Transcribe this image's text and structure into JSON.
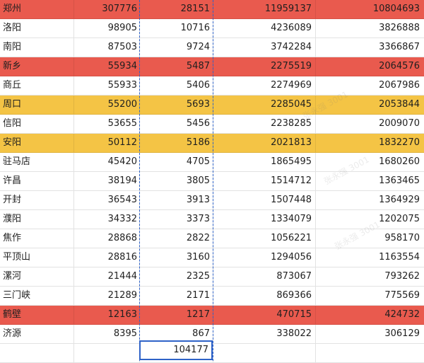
{
  "rows": [
    {
      "city": "郑州",
      "c1": "307776",
      "c2": "28151",
      "c3": "11959137",
      "c4": "10804693",
      "highlight": "red"
    },
    {
      "city": "洛阳",
      "c1": "98905",
      "c2": "10716",
      "c3": "4236089",
      "c4": "3826888",
      "highlight": ""
    },
    {
      "city": "南阳",
      "c1": "87503",
      "c2": "9724",
      "c3": "3742284",
      "c4": "3366867",
      "highlight": ""
    },
    {
      "city": "新乡",
      "c1": "55934",
      "c2": "5487",
      "c3": "2275519",
      "c4": "2064576",
      "highlight": "red"
    },
    {
      "city": "商丘",
      "c1": "55933",
      "c2": "5406",
      "c3": "2274969",
      "c4": "2067986",
      "highlight": ""
    },
    {
      "city": "周口",
      "c1": "55200",
      "c2": "5693",
      "c3": "2285045",
      "c4": "2053844",
      "highlight": "yellow"
    },
    {
      "city": "信阳",
      "c1": "53655",
      "c2": "5456",
      "c3": "2238285",
      "c4": "2009070",
      "highlight": ""
    },
    {
      "city": "安阳",
      "c1": "50112",
      "c2": "5186",
      "c3": "2021813",
      "c4": "1832270",
      "highlight": "yellow"
    },
    {
      "city": "驻马店",
      "c1": "45420",
      "c2": "4705",
      "c3": "1865495",
      "c4": "1680260",
      "highlight": ""
    },
    {
      "city": "许昌",
      "c1": "38194",
      "c2": "3805",
      "c3": "1514712",
      "c4": "1363465",
      "highlight": ""
    },
    {
      "city": "开封",
      "c1": "36543",
      "c2": "3913",
      "c3": "1507448",
      "c4": "1364929",
      "highlight": ""
    },
    {
      "city": "濮阳",
      "c1": "34332",
      "c2": "3373",
      "c3": "1334079",
      "c4": "1202075",
      "highlight": ""
    },
    {
      "city": "焦作",
      "c1": "28868",
      "c2": "2822",
      "c3": "1056221",
      "c4": "958170",
      "highlight": ""
    },
    {
      "city": "平顶山",
      "c1": "28816",
      "c2": "3160",
      "c3": "1294056",
      "c4": "1163554",
      "highlight": ""
    },
    {
      "city": "漯河",
      "c1": "21444",
      "c2": "2325",
      "c3": "873067",
      "c4": "793262",
      "highlight": ""
    },
    {
      "city": "三门峡",
      "c1": "21289",
      "c2": "2171",
      "c3": "869366",
      "c4": "775569",
      "highlight": ""
    },
    {
      "city": "鹤壁",
      "c1": "12163",
      "c2": "1217",
      "c3": "470715",
      "c4": "424732",
      "highlight": "red"
    },
    {
      "city": "济源",
      "c1": "8395",
      "c2": "867",
      "c3": "338022",
      "c4": "306129",
      "highlight": ""
    },
    {
      "city": "",
      "c1": "",
      "c2": "",
      "c3": "",
      "c4": "",
      "highlight": ""
    }
  ],
  "sum_cell": "104177",
  "colors": {
    "red": "#e95a4e",
    "yellow": "#f4c445",
    "selection": "#2f63c8"
  },
  "watermark_text": "张永强 3001"
}
